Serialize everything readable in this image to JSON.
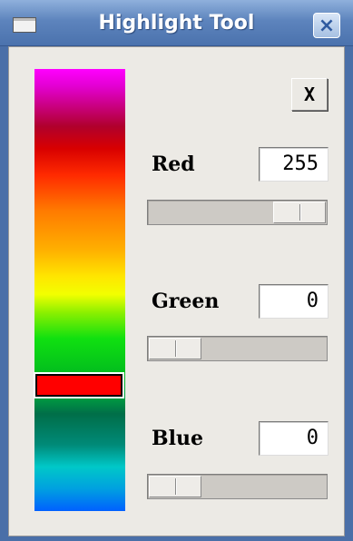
{
  "window": {
    "title": "Highlight Tool",
    "titlebar_close_glyph": "×",
    "icons": {
      "window_icon": "window-icon",
      "titlebar_close": "close-icon"
    }
  },
  "panel": {
    "close_label": "X",
    "spectrum": {
      "colors_top_to_bottom": [
        "#ff00ff",
        "#b0002c",
        "#d80000",
        "#ff7a00",
        "#ffe600",
        "#10e010",
        "#006e48",
        "#00c8c8",
        "#0060ff"
      ],
      "marker_color": "#ff0000"
    },
    "channels": [
      {
        "label": "Red",
        "value": "255",
        "slider_fraction": 1.0
      },
      {
        "label": "Green",
        "value": "0",
        "slider_fraction": 0.0
      },
      {
        "label": "Blue",
        "value": "0",
        "slider_fraction": 0.0
      }
    ]
  },
  "colors": {
    "titlebar": "#5d84bd",
    "client_bg": "#eceae5",
    "slider_trough": "#cdcac5"
  }
}
